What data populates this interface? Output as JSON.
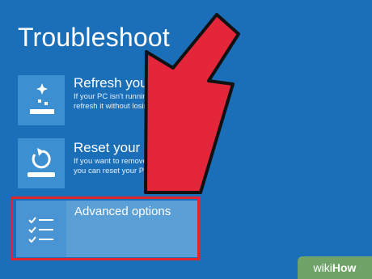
{
  "screen": {
    "title": "Troubleshoot"
  },
  "items": [
    {
      "title": "Refresh your P",
      "desc_line1": "If your PC isn't running w",
      "desc_line2": "refresh it without losing",
      "icon": "refresh-sparkle-icon"
    },
    {
      "title": "Reset your PC",
      "desc_line1": "If you want to remove a",
      "desc_line2": "you can reset your PC c",
      "icon": "reset-icon"
    },
    {
      "title": "Advanced options",
      "icon": "checklist-icon"
    }
  ],
  "watermark": {
    "wiki": "wiki",
    "how": "How"
  },
  "colors": {
    "background": "#1a6fb8",
    "highlight_border": "#e3252b",
    "arrow": "#e3263a"
  }
}
